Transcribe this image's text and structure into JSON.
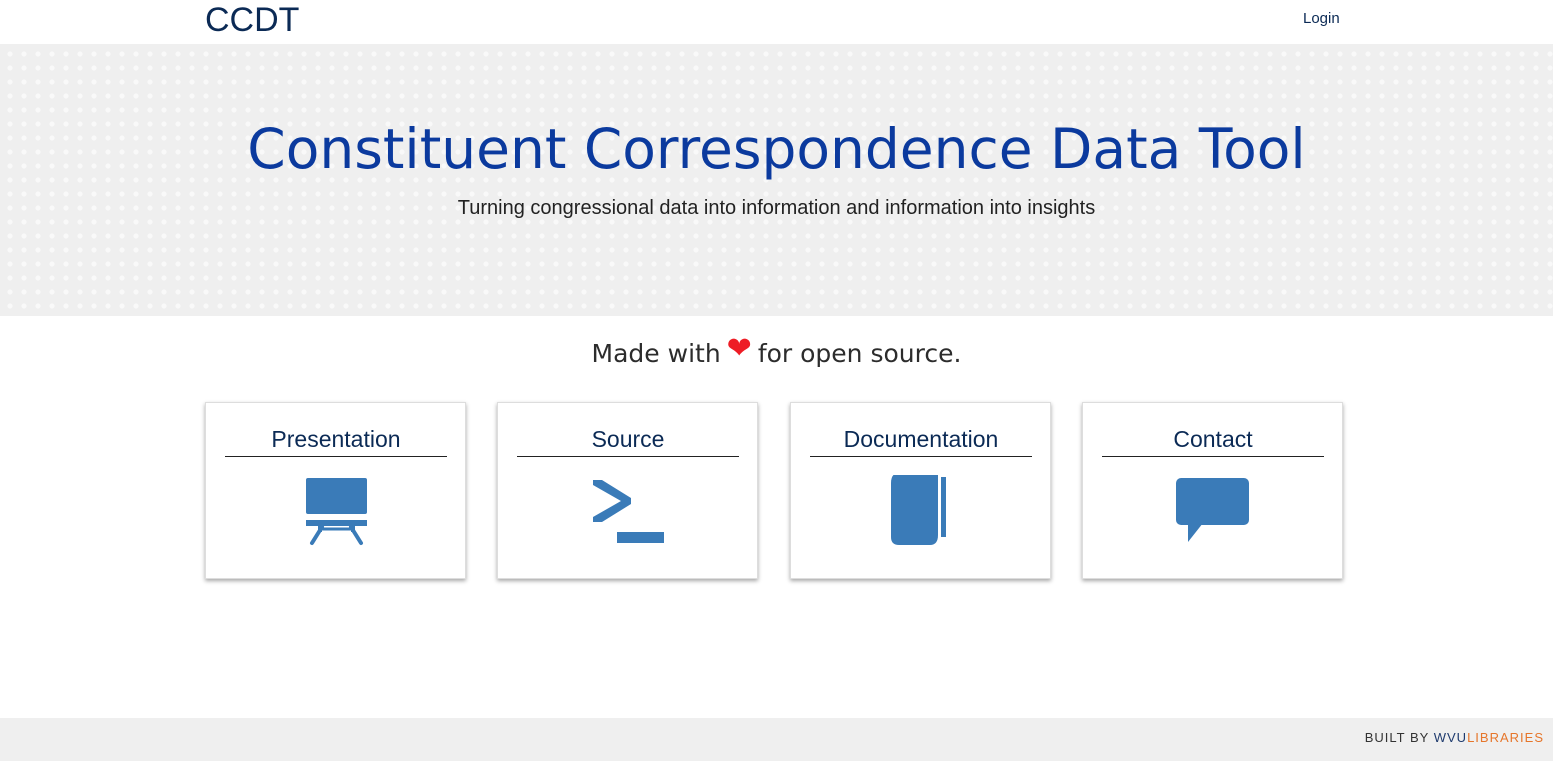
{
  "header": {
    "brand": "CCDT",
    "login_label": "Login"
  },
  "hero": {
    "title": "Constituent Correspondence Data Tool",
    "subtitle": "Turning congressional data into information and information into insights"
  },
  "made_with": {
    "prefix": "Made with",
    "heart": "❤",
    "suffix": "for open source."
  },
  "cards": [
    {
      "label": "Presentation",
      "icon": "presentation-icon"
    },
    {
      "label": "Source",
      "icon": "terminal-icon"
    },
    {
      "label": "Documentation",
      "icon": "book-icon"
    },
    {
      "label": "Contact",
      "icon": "comment-icon"
    }
  ],
  "footer": {
    "built_by": "BUILT BY",
    "wvu": "WVU",
    "libraries": "LIBRARIES"
  },
  "colors": {
    "icon_blue": "#3a7bb8",
    "title_blue": "#0b3a9e",
    "heart_red": "#ee1c25",
    "libraries_orange": "#e6762b"
  }
}
